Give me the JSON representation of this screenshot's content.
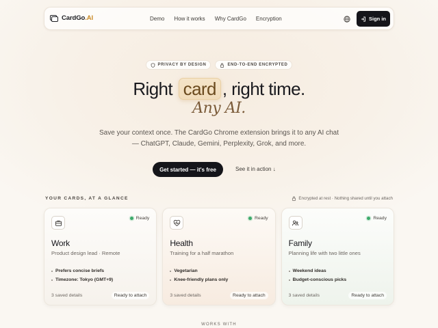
{
  "nav": {
    "brand_prefix": "CardGo",
    "brand_suffix": ".AI",
    "links": [
      "Demo",
      "How it works",
      "Why CardGo",
      "Encryption"
    ],
    "signin_label": "Sign in"
  },
  "badges": [
    "PRIVACY BY DESIGN",
    "END-TO-END ENCRYPTED"
  ],
  "hero": {
    "title_start": "Right",
    "title_pill": "card",
    "title_end": ", right time.",
    "subtitle": "Any AI.",
    "description": "Save your context once. The CardGo Chrome extension brings it to any AI chat — ChatGPT, Claude, Gemini, Perplexity, Grok, and more.",
    "cta_label": "Get started — it's free",
    "secondary_label": "See it in action ↓"
  },
  "section": {
    "label": "YOUR CARDS, AT A GLANCE",
    "note": "Encrypted at rest · Nothing shared until you attach"
  },
  "cards": [
    {
      "title": "Work",
      "subtitle": "Product design lead · Remote",
      "status": "Ready",
      "icon": "briefcase-icon",
      "items": [
        "Prefers concise briefs",
        "Timezone: Tokyo (GMT+9)"
      ],
      "saved": "3 saved details",
      "attach_label": "Ready to attach"
    },
    {
      "title": "Health",
      "subtitle": "Training for a half marathon",
      "status": "Ready",
      "icon": "heart-pulse-icon",
      "items": [
        "Vegetarian",
        "Knee-friendly plans only"
      ],
      "saved": "3 saved details",
      "attach_label": "Ready to attach"
    },
    {
      "title": "Family",
      "subtitle": "Planning life with two little ones",
      "status": "Ready",
      "icon": "family-icon",
      "items": [
        "Weekend ideas",
        "Budget-conscious picks"
      ],
      "saved": "3 saved details",
      "attach_label": "Ready to attach"
    }
  ],
  "works_with_label": "WORKS WITH",
  "colors": {
    "accent": "#c98a25",
    "dark": "#15151a",
    "ready_green": "#3caa6a"
  }
}
